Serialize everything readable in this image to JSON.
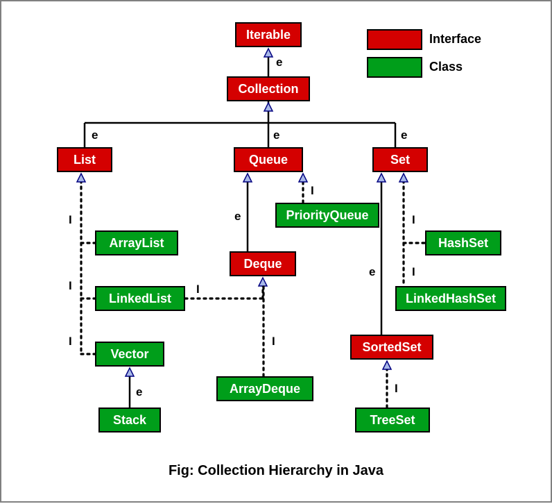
{
  "legend": {
    "interface_label": "Interface",
    "class_label": "Class",
    "interface_color": "#d40000",
    "class_color": "#009e1a"
  },
  "caption": "Fig:  Collection Hierarchy in Java",
  "nodes": {
    "iterable": "Iterable",
    "collection": "Collection",
    "list": "List",
    "queue": "Queue",
    "set": "Set",
    "deque": "Deque",
    "sortedset": "SortedSet",
    "arraylist": "ArrayList",
    "linkedlist": "LinkedList",
    "vector": "Vector",
    "stack": "Stack",
    "priorityqueue": "PriorityQueue",
    "arraydeque": "ArrayDeque",
    "hashset": "HashSet",
    "linkedhashset": "LinkedHashSet",
    "treeset": "TreeSet"
  },
  "edge_labels": {
    "e": "e",
    "i": "I"
  },
  "chart_data": {
    "type": "diagram",
    "title": "Collection Hierarchy in Java",
    "node_types": {
      "interface": [
        "Iterable",
        "Collection",
        "List",
        "Queue",
        "Set",
        "Deque",
        "SortedSet"
      ],
      "class": [
        "ArrayList",
        "LinkedList",
        "Vector",
        "Stack",
        "PriorityQueue",
        "ArrayDeque",
        "HashSet",
        "LinkedHashSet",
        "TreeSet"
      ]
    },
    "edges": [
      {
        "from": "Collection",
        "to": "Iterable",
        "relation": "extends"
      },
      {
        "from": "List",
        "to": "Collection",
        "relation": "extends"
      },
      {
        "from": "Queue",
        "to": "Collection",
        "relation": "extends"
      },
      {
        "from": "Set",
        "to": "Collection",
        "relation": "extends"
      },
      {
        "from": "Deque",
        "to": "Queue",
        "relation": "extends"
      },
      {
        "from": "SortedSet",
        "to": "Set",
        "relation": "extends"
      },
      {
        "from": "ArrayList",
        "to": "List",
        "relation": "implements"
      },
      {
        "from": "LinkedList",
        "to": "List",
        "relation": "implements"
      },
      {
        "from": "LinkedList",
        "to": "Deque",
        "relation": "implements"
      },
      {
        "from": "Vector",
        "to": "List",
        "relation": "implements"
      },
      {
        "from": "Stack",
        "to": "Vector",
        "relation": "extends"
      },
      {
        "from": "PriorityQueue",
        "to": "Queue",
        "relation": "implements"
      },
      {
        "from": "ArrayDeque",
        "to": "Deque",
        "relation": "implements"
      },
      {
        "from": "HashSet",
        "to": "Set",
        "relation": "implements"
      },
      {
        "from": "LinkedHashSet",
        "to": "Set",
        "relation": "implements"
      },
      {
        "from": "TreeSet",
        "to": "SortedSet",
        "relation": "implements"
      }
    ],
    "annotations": {
      "e": "extends",
      "I": "implements"
    }
  }
}
